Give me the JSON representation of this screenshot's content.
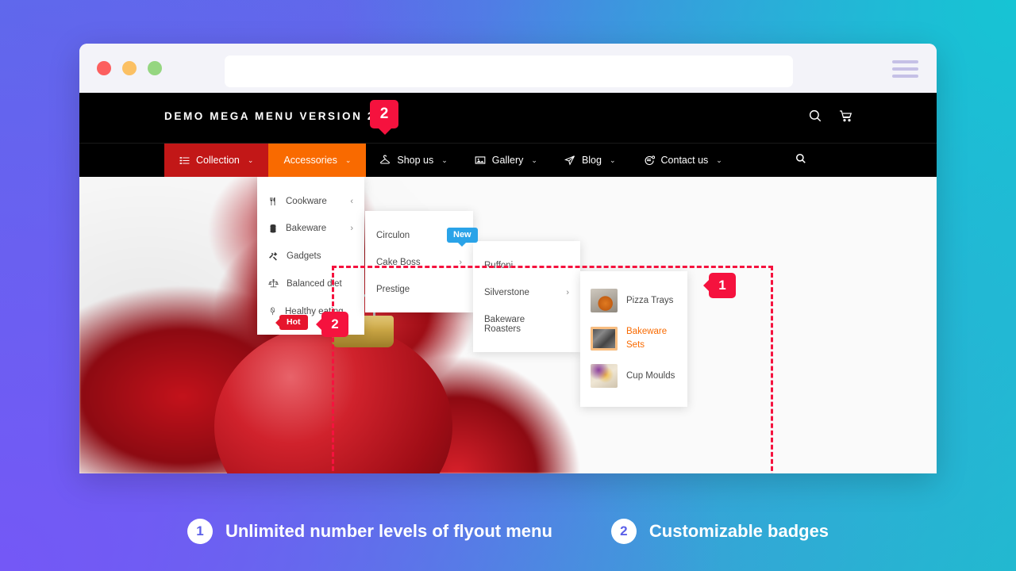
{
  "browser": {
    "dots": [
      "close",
      "minimize",
      "maximize"
    ],
    "url_value": "",
    "url_placeholder": "",
    "menu_icon": "hamburger-icon"
  },
  "site": {
    "brand": "DEMO MEGA MENU VERSION 2",
    "top_icons": [
      "search-icon",
      "cart-icon"
    ],
    "nav": [
      {
        "label": "Collection",
        "icon": "list-icon",
        "caret": "⌄",
        "state": "active-red"
      },
      {
        "label": "Accessories",
        "icon": "",
        "caret": "⌄",
        "state": "active-orange"
      },
      {
        "label": "Shop us",
        "icon": "hanger-icon",
        "caret": "⌄",
        "state": "default",
        "badge": "New"
      },
      {
        "label": "Gallery",
        "icon": "image-icon",
        "caret": "⌄",
        "state": "default"
      },
      {
        "label": "Blog",
        "icon": "send-icon",
        "caret": "⌄",
        "state": "default"
      },
      {
        "label": "Contact us",
        "icon": "chat-icon",
        "caret": "⌄",
        "state": "default"
      }
    ],
    "nav_search_icon": "search-icon"
  },
  "menus": {
    "level1": [
      {
        "label": "Cookware",
        "icon": "fork-knife-icon",
        "arrow": "‹"
      },
      {
        "label": "Bakeware",
        "icon": "layers-icon",
        "arrow": "›"
      },
      {
        "label": "Gadgets",
        "icon": "tools-icon",
        "arrow": ""
      },
      {
        "label": "Balanced diet",
        "icon": "scales-icon",
        "arrow": ""
      },
      {
        "label": "Healthy eating",
        "icon": "whisk-icon",
        "arrow": "",
        "badge": "Hot"
      }
    ],
    "level2": [
      {
        "label": "Circulon",
        "arrow": ""
      },
      {
        "label": "Cake Boss",
        "arrow": "›"
      },
      {
        "label": "Prestige",
        "arrow": ""
      }
    ],
    "level3": [
      {
        "label": "Ruffoni",
        "arrow": ""
      },
      {
        "label": "Silverstone",
        "arrow": "›"
      },
      {
        "label": "Bakeware Roasters",
        "arrow": ""
      }
    ],
    "level4": [
      {
        "label": "Pizza Trays",
        "thumb": "pizza-tray-thumb",
        "highlight": false
      },
      {
        "label": "Bakeware Sets",
        "thumb": "bakeware-set-thumb",
        "highlight": true
      },
      {
        "label": "Cup Moulds",
        "thumb": "cup-mould-thumb",
        "highlight": false
      }
    ]
  },
  "annotations": {
    "marker_badge_top": "2",
    "marker_flyout": "1",
    "marker_badge_hot": "2"
  },
  "caption": [
    {
      "num": "1",
      "text": "Unlimited number levels of flyout menu"
    },
    {
      "num": "2",
      "text": "Customizable badges"
    }
  ],
  "colors": {
    "accent_pink": "#f5123e",
    "nav_red": "#c21717",
    "nav_orange": "#f96a00",
    "badge_blue": "#2aa3e8",
    "badge_hot_red": "#e6162d",
    "gradient_from": "#5b6de8",
    "gradient_to": "#16c4d4"
  }
}
